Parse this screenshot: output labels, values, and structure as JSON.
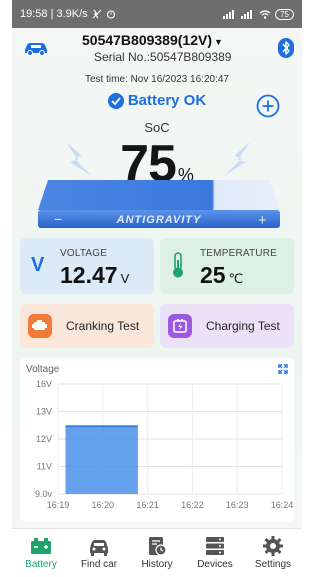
{
  "status_bar": {
    "time_speed": "19:58 | 3.9K/s",
    "battery_level": "75"
  },
  "header": {
    "device_name": "50547B809389(12V)",
    "serial": "Serial No.:50547B809389"
  },
  "summary": {
    "test_time": "Test time: Nov 16/2023 16:20:47",
    "status": "Battery OK",
    "soc_label": "SoC",
    "soc_value": "75",
    "soc_unit": "%",
    "brand": "ANTIGRAVITY"
  },
  "metrics": {
    "voltage_icon": "V",
    "voltage_label": "VOLTAGE",
    "voltage_value": "12.47",
    "voltage_unit": "V",
    "temperature_label": "TEMPERATURE",
    "temperature_value": "25",
    "temperature_unit": "℃"
  },
  "tests": {
    "cranking_label": "Cranking Test",
    "charging_label": "Charging Test"
  },
  "chart_title": "Voltage",
  "chart_data": {
    "type": "area",
    "title": "Voltage",
    "x_ticks": [
      "16:19",
      "16:20",
      "16:21",
      "16:22",
      "16:23",
      "16:24"
    ],
    "y_ticks": [
      "16V",
      "13V",
      "12V",
      "11V",
      "9.0v"
    ],
    "series": [
      {
        "x": [
          "16:19:10",
          "16:20:47"
        ],
        "y": [
          12.47,
          12.47
        ]
      }
    ],
    "grid": true,
    "fill_color": "#4a8fe8"
  },
  "nav": {
    "items": [
      {
        "label": "Battery",
        "icon": "battery-icon",
        "active": true
      },
      {
        "label": "Find car",
        "icon": "car-icon",
        "active": false
      },
      {
        "label": "History",
        "icon": "history-icon",
        "active": false
      },
      {
        "label": "Devices",
        "icon": "devices-icon",
        "active": false
      },
      {
        "label": "Settings",
        "icon": "settings-icon",
        "active": false
      }
    ]
  },
  "colors": {
    "accent_blue": "#1d6fe0",
    "accent_green": "#1ea46b",
    "battery_body": "#2f6fd6"
  }
}
